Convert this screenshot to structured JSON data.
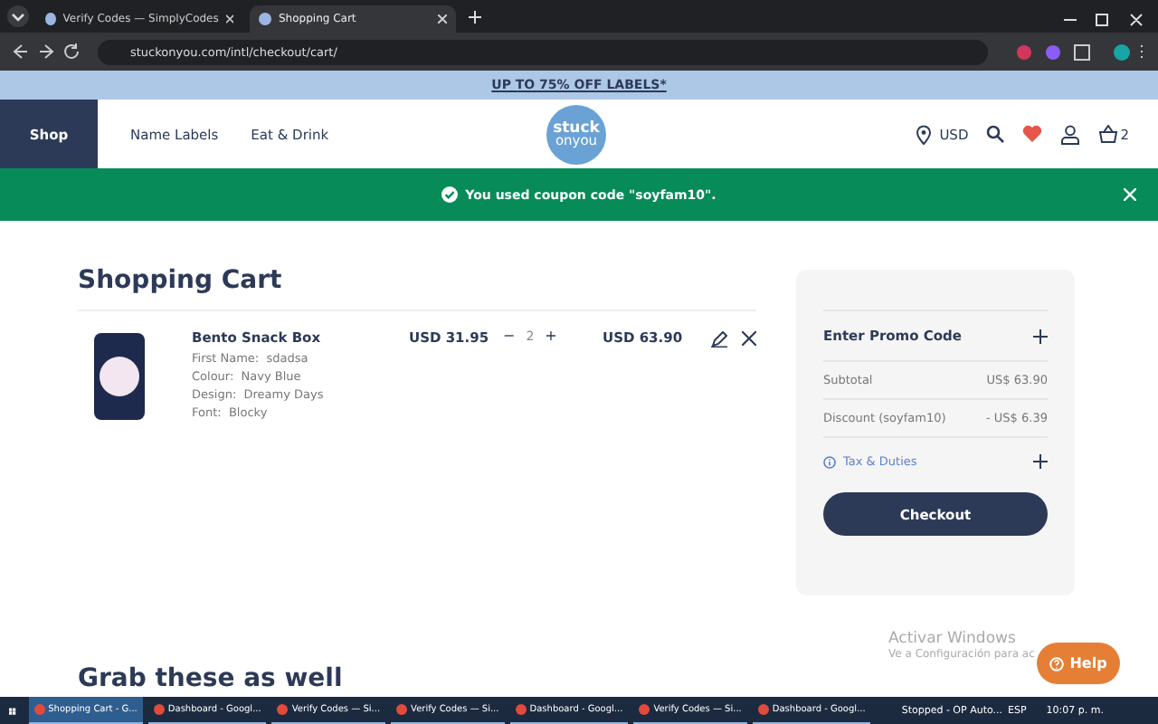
{
  "browser": {
    "tabs": [
      {
        "title": "Verify Codes — SimplyCodes",
        "selected": false
      },
      {
        "title": "Shopping Cart",
        "selected": true
      }
    ],
    "url": "stuckonyou.com/intl/checkout/cart/"
  },
  "promo_banner": "UP TO 75% OFF LABELS*",
  "nav": {
    "shop": "Shop",
    "links": [
      "Name Labels",
      "Eat & Drink"
    ],
    "logo": [
      "stuck",
      "onyou"
    ],
    "currency": "USD",
    "cart_count": "2"
  },
  "notice": "You used coupon code \"soyfam10\".",
  "cart": {
    "title": "Shopping Cart",
    "items": [
      {
        "name": "Bento Snack Box",
        "options": [
          "First Name:  sdadsa",
          "Colour:  Navy Blue",
          "Design:  Dreamy Days",
          "Font:  Blocky"
        ],
        "price": "USD 31.95",
        "qty_minus": "−",
        "qty": "2",
        "qty_plus": "+",
        "total": "USD 63.90"
      }
    ]
  },
  "summary": {
    "promo": "Enter Promo Code",
    "rows": [
      {
        "label": "Subtotal",
        "value": "US$ 63.90"
      },
      {
        "label": "Discount (soyfam10)",
        "value": "- US$ 6.39"
      }
    ],
    "tax": "Tax & Duties",
    "checkout": "Checkout"
  },
  "related_title": "Grab these as well",
  "help": "Help",
  "activation": {
    "title": "Activar Windows",
    "hint": "Ve a Configuración para ac"
  },
  "taskbar": {
    "items": [
      {
        "title": "Shopping Cart - G...",
        "selected": true
      },
      {
        "title": "Dashboard - Googl...",
        "selected": false
      },
      {
        "title": "Verify Codes — Si...",
        "selected": false
      },
      {
        "title": "Verify Codes — Si...",
        "selected": false
      },
      {
        "title": "Dashboard - Googl...",
        "selected": false
      },
      {
        "title": "Verify Codes — Si...",
        "selected": false
      },
      {
        "title": "Dashboard - Googl...",
        "selected": false
      }
    ],
    "status": "Stopped - OP Auto...",
    "lang": "ESP",
    "time": "10:07 p. m."
  }
}
